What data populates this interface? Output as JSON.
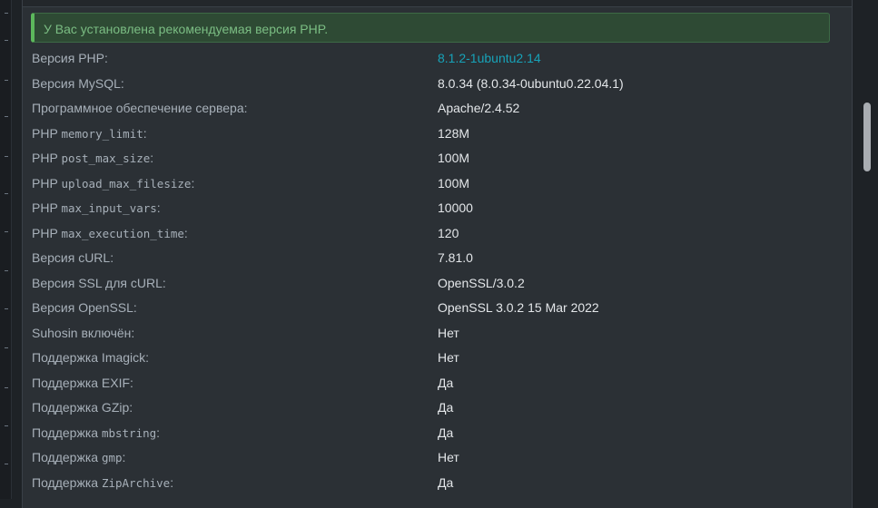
{
  "alert": {
    "text": "У Вас установлена рекомендуемая версия PHP."
  },
  "rows": [
    {
      "label_prefix": "Версия PHP:",
      "label_code": "",
      "label_suffix": "",
      "value": "8.1.2-1ubuntu2.14",
      "is_link": true
    },
    {
      "label_prefix": "Версия MySQL:",
      "label_code": "",
      "label_suffix": "",
      "value": "8.0.34 (8.0.34-0ubuntu0.22.04.1)",
      "is_link": false
    },
    {
      "label_prefix": "Программное обеспечение сервера:",
      "label_code": "",
      "label_suffix": "",
      "value": "Apache/2.4.52",
      "is_link": false
    },
    {
      "label_prefix": "PHP ",
      "label_code": "memory_limit",
      "label_suffix": ":",
      "value": "128M",
      "is_link": false
    },
    {
      "label_prefix": "PHP ",
      "label_code": "post_max_size",
      "label_suffix": ":",
      "value": "100M",
      "is_link": false
    },
    {
      "label_prefix": "PHP ",
      "label_code": "upload_max_filesize",
      "label_suffix": ":",
      "value": "100M",
      "is_link": false
    },
    {
      "label_prefix": "PHP ",
      "label_code": "max_input_vars",
      "label_suffix": ":",
      "value": "10000",
      "is_link": false
    },
    {
      "label_prefix": "PHP ",
      "label_code": "max_execution_time",
      "label_suffix": ":",
      "value": "120",
      "is_link": false
    },
    {
      "label_prefix": "Версия cURL:",
      "label_code": "",
      "label_suffix": "",
      "value": "7.81.0",
      "is_link": false
    },
    {
      "label_prefix": "Версия SSL для cURL:",
      "label_code": "",
      "label_suffix": "",
      "value": "OpenSSL/3.0.2",
      "is_link": false
    },
    {
      "label_prefix": "Версия OpenSSL:",
      "label_code": "",
      "label_suffix": "",
      "value": "OpenSSL 3.0.2 15 Mar 2022",
      "is_link": false
    },
    {
      "label_prefix": "Suhosin включён:",
      "label_code": "",
      "label_suffix": "",
      "value": "Нет",
      "is_link": false
    },
    {
      "label_prefix": "Поддержка Imagick:",
      "label_code": "",
      "label_suffix": "",
      "value": "Нет",
      "is_link": false
    },
    {
      "label_prefix": "Поддержка EXIF:",
      "label_code": "",
      "label_suffix": "",
      "value": "Да",
      "is_link": false
    },
    {
      "label_prefix": "Поддержка GZip:",
      "label_code": "",
      "label_suffix": "",
      "value": "Да",
      "is_link": false
    },
    {
      "label_prefix": "Поддержка ",
      "label_code": "mbstring",
      "label_suffix": ":",
      "value": "Да",
      "is_link": false
    },
    {
      "label_prefix": "Поддержка ",
      "label_code": "gmp",
      "label_suffix": ":",
      "value": "Нет",
      "is_link": false
    },
    {
      "label_prefix": "Поддержка ",
      "label_code": "ZipArchive",
      "label_suffix": ":",
      "value": "Да",
      "is_link": false
    }
  ]
}
